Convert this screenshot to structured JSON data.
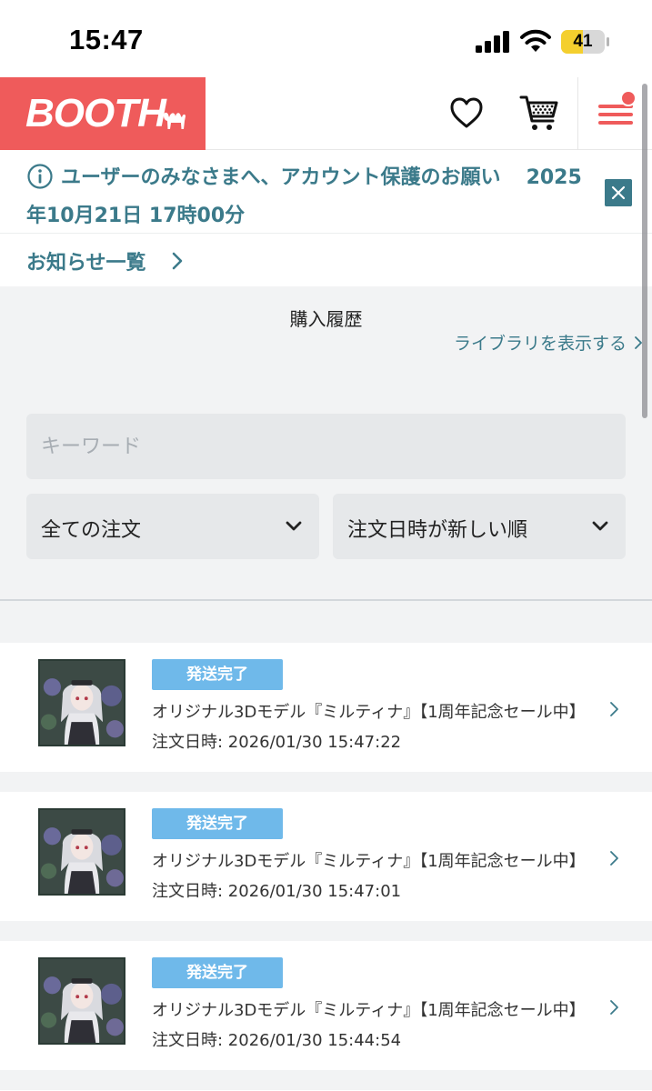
{
  "status_bar": {
    "time": "15:47",
    "battery_level": "41",
    "icons": [
      "signal-icon",
      "wifi-icon",
      "battery-icon"
    ]
  },
  "header": {
    "logo_text": "BOOTH",
    "icons": [
      "camel-icon",
      "heart-icon",
      "cart-icon",
      "menu-icon"
    ],
    "brand_color": "#ef5b5b"
  },
  "notice": {
    "message": "ユーザーのみなさまへ、アカウント保護のお願い",
    "date": "2025年10月21日 17時00分",
    "list_link": "お知らせ一覧",
    "accent_color": "#3b7a8a"
  },
  "page": {
    "title": "購入履歴",
    "library_link": "ライブラリを表示する"
  },
  "filters": {
    "keyword_placeholder": "キーワード",
    "order_type": "全ての注文",
    "sort": "注文日時が新しい順"
  },
  "orders": [
    {
      "status": "発送完了",
      "title": "オリジナル3Dモデル『ミルティナ』【1周年記念セール中】",
      "date": "注文日時: 2026/01/30 15:47:22"
    },
    {
      "status": "発送完了",
      "title": "オリジナル3Dモデル『ミルティナ』【1周年記念セール中】",
      "date": "注文日時: 2026/01/30 15:47:01"
    },
    {
      "status": "発送完了",
      "title": "オリジナル3Dモデル『ミルティナ』【1周年記念セール中】",
      "date": "注文日時: 2026/01/30 15:44:54"
    }
  ]
}
